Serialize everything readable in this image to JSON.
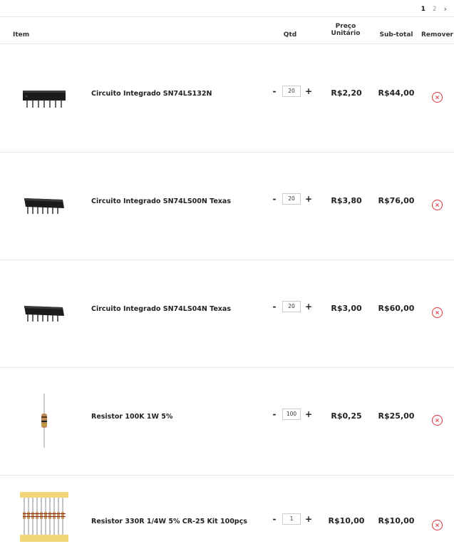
{
  "pagination": {
    "current": "1",
    "pages": [
      "2"
    ],
    "next_icon": "chevron-right-icon",
    "next_symbol": "›"
  },
  "table_header": {
    "item": "Item",
    "qtd": "Qtd",
    "preco_line1": "Preço",
    "preco_line2": "Unitário",
    "subtotal": "Sub-total",
    "remover": "Remover"
  },
  "colors": {
    "remove": "#e0323c",
    "divider": "#e8e8e8"
  },
  "items": [
    {
      "name": "Circuito Integrado SN74LS132N",
      "qty": "20",
      "unit_price": "R$2,20",
      "subtotal": "R$44,00",
      "image": "ic-chip-image"
    },
    {
      "name": "Circuito Integrado SN74LS00N Texas",
      "qty": "20",
      "unit_price": "R$3,80",
      "subtotal": "R$76,00",
      "image": "ic-chip-image"
    },
    {
      "name": "Circuito Integrado SN74LS04N Texas",
      "qty": "20",
      "unit_price": "R$3,00",
      "subtotal": "R$60,00",
      "image": "ic-chip-image"
    },
    {
      "name": "Resistor 100K 1W 5%",
      "qty": "100",
      "unit_price": "R$0,25",
      "subtotal": "R$25,00",
      "image": "resistor-image"
    },
    {
      "name": "Resistor 330R 1/4W 5% CR-25 Kit 100pçs",
      "qty": "1",
      "unit_price": "R$10,00",
      "subtotal": "R$10,00",
      "image": "resistor-kit-image"
    }
  ],
  "qty_minus": "-",
  "qty_plus": "+",
  "remove_symbol": "×"
}
